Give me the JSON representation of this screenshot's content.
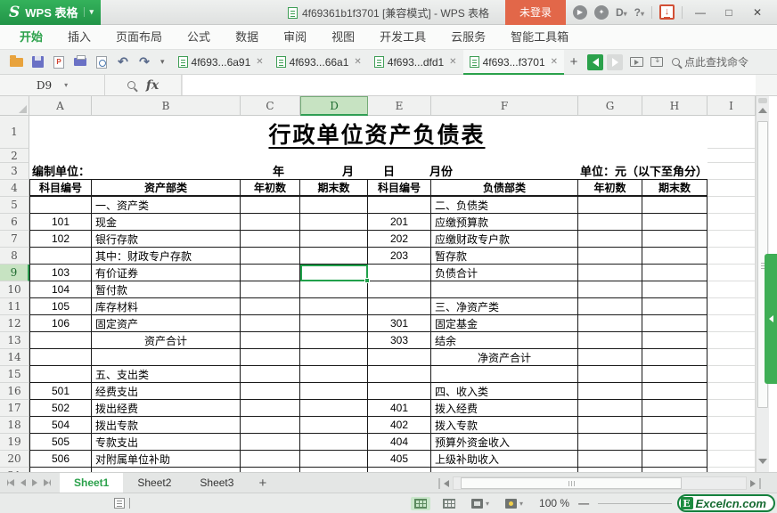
{
  "colors": {
    "accent_green": "#2ba14b",
    "login_red": "#e26749",
    "selection_green": "#21a14b"
  },
  "titlebar": {
    "app_name": "WPS 表格",
    "doc_title": "4f69361b1f3701 [兼容模式] - WPS 表格",
    "login": "未登录",
    "window": {
      "minimize": "—",
      "maximize": "□",
      "close": "✕"
    }
  },
  "ribbon": {
    "active_index": 0,
    "tabs": [
      "开始",
      "插入",
      "页面布局",
      "公式",
      "数据",
      "审阅",
      "视图",
      "开发工具",
      "云服务",
      "智能工具箱"
    ]
  },
  "quickbar": {
    "undo": "↶",
    "redo": "↷",
    "pdf_label": "P"
  },
  "doc_tabs": [
    {
      "label": "4f693...6a91",
      "active": false
    },
    {
      "label": "4f693...66a1",
      "active": false
    },
    {
      "label": "4f693...dfd1",
      "active": false
    },
    {
      "label": "4f693...f3701",
      "active": true
    }
  ],
  "command_search": {
    "label": "点此查找命令"
  },
  "formula_bar": {
    "name_box": "D9",
    "fx_label": "fx"
  },
  "grid": {
    "columns": [
      "A",
      "B",
      "C",
      "D",
      "E",
      "F",
      "G",
      "H",
      "I"
    ],
    "selected_cell": "D9",
    "selected_column": "D",
    "selected_row": 9,
    "title": "行政单位资产负债表",
    "row3": {
      "label": "编制单位：",
      "year": "年",
      "month": "月",
      "day": "日",
      "period": "月份",
      "unit": "单位：元（以下至角分）"
    },
    "header_labels": [
      "科目编号",
      "资产部类",
      "年初数",
      "期末数",
      "科目编号",
      "负债部类",
      "年初数",
      "期末数"
    ],
    "rows": [
      {
        "n": 5,
        "A": "",
        "B": "一、资产类",
        "E": "",
        "F": "二、负债类",
        "centerB": false,
        "centerF": false
      },
      {
        "n": 6,
        "A": "101",
        "B": "现金",
        "E": "201",
        "F": "应缴预算款",
        "centerB": false,
        "centerF": false
      },
      {
        "n": 7,
        "A": "102",
        "B": "银行存款",
        "E": "202",
        "F": "应缴财政专户款",
        "centerB": false,
        "centerF": false
      },
      {
        "n": 8,
        "A": "",
        "B": "其中：财政专户存款",
        "E": "203",
        "F": "暂存款",
        "centerB": false,
        "centerF": false
      },
      {
        "n": 9,
        "A": "103",
        "B": "有价证券",
        "E": "",
        "F": "负债合计",
        "centerB": false,
        "centerF": false
      },
      {
        "n": 10,
        "A": "104",
        "B": "暂付款",
        "E": "",
        "F": "",
        "centerB": false,
        "centerF": false
      },
      {
        "n": 11,
        "A": "105",
        "B": "库存材料",
        "E": "",
        "F": "三、净资产类",
        "centerB": false,
        "centerF": false
      },
      {
        "n": 12,
        "A": "106",
        "B": "固定资产",
        "E": "301",
        "F": "固定基金",
        "centerB": false,
        "centerF": false
      },
      {
        "n": 13,
        "A": "",
        "B": "资产合计",
        "E": "303",
        "F": "结余",
        "centerB": true,
        "centerF": false
      },
      {
        "n": 14,
        "A": "",
        "B": "",
        "E": "",
        "F": "净资产合计",
        "centerB": false,
        "centerF": true
      },
      {
        "n": 15,
        "A": "",
        "B": "五、支出类",
        "E": "",
        "F": "",
        "centerB": false,
        "centerF": false
      },
      {
        "n": 16,
        "A": "501",
        "B": "经费支出",
        "E": "",
        "F": "四、收入类",
        "centerB": false,
        "centerF": false
      },
      {
        "n": 17,
        "A": "502",
        "B": "拨出经费",
        "E": "401",
        "F": "拨入经费",
        "centerB": false,
        "centerF": false
      },
      {
        "n": 18,
        "A": "504",
        "B": "拨出专款",
        "E": "402",
        "F": "拨入专款",
        "centerB": false,
        "centerF": false
      },
      {
        "n": 19,
        "A": "505",
        "B": "专款支出",
        "E": "404",
        "F": "预算外资金收入",
        "centerB": false,
        "centerF": false
      },
      {
        "n": 20,
        "A": "506",
        "B": "对附属单位补助",
        "E": "405",
        "F": "上级补助收入",
        "centerB": false,
        "centerF": false
      },
      {
        "n": 21,
        "A": "",
        "B": "",
        "E": "",
        "F": "",
        "centerB": false,
        "centerF": false
      }
    ]
  },
  "sheet_tabs": {
    "active_index": 0,
    "tabs": [
      "Sheet1",
      "Sheet2",
      "Sheet3"
    ]
  },
  "statusbar": {
    "zoom_level": "100 %",
    "zoom_minus": "—"
  },
  "brand": {
    "logo_letter": "E",
    "logo_text": "Excelcn.com"
  }
}
